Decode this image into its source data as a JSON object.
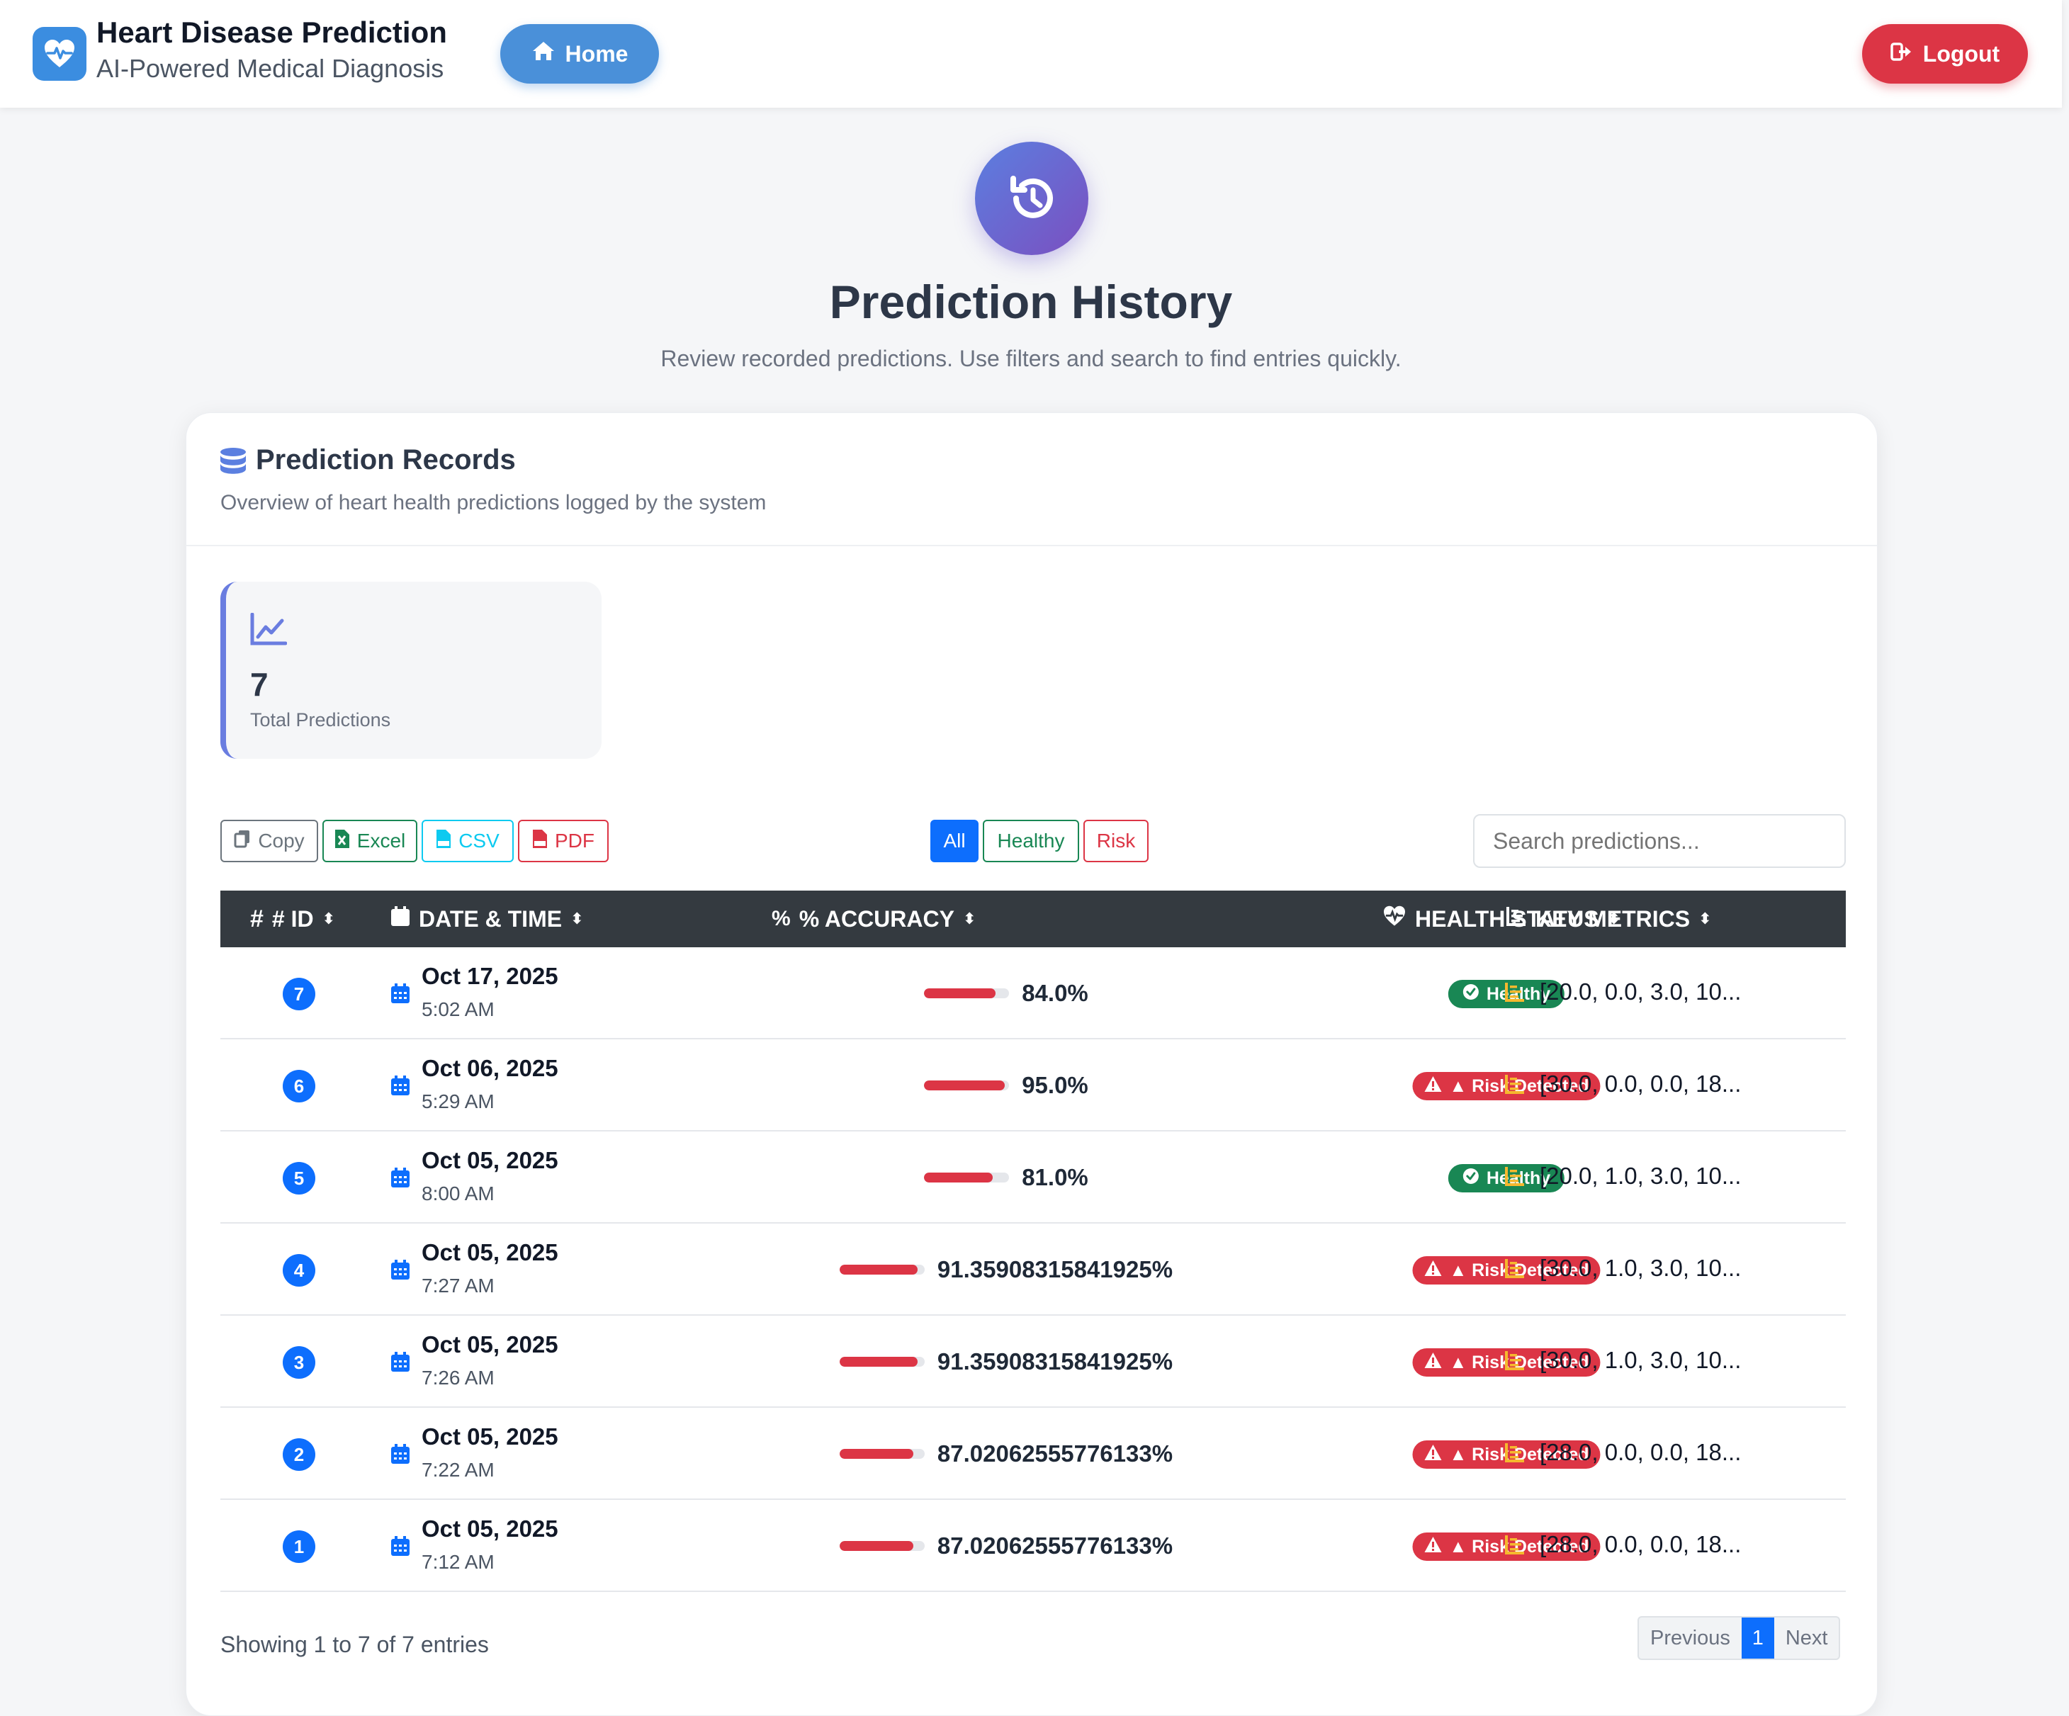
{
  "brand": {
    "title": "Heart Disease Prediction",
    "subtitle": "AI-Powered Medical Diagnosis"
  },
  "nav": {
    "home_label": "Home",
    "logout_label": "Logout"
  },
  "hero": {
    "title": "Prediction History",
    "subtitle": "Review recorded predictions. Use filters and search to find entries quickly."
  },
  "card": {
    "title": "Prediction Records",
    "subtitle": "Overview of heart health predictions logged by the system"
  },
  "stats": {
    "total_value": "7",
    "total_label": "Total Predictions"
  },
  "export_buttons": {
    "copy": "Copy",
    "excel": "Excel",
    "csv": "CSV",
    "pdf": "PDF"
  },
  "filters": {
    "all": "All",
    "healthy": "Healthy",
    "risk": "Risk"
  },
  "search": {
    "placeholder": "Search predictions..."
  },
  "table": {
    "headers": {
      "id": "# ID",
      "datetime": "DATE & TIME",
      "accuracy": "% ACCURACY",
      "status": "HEALTH STATUS",
      "metrics": "KEY METRICS"
    },
    "rows": [
      {
        "id": "7",
        "date": "Oct 17, 2025",
        "time": "5:02 AM",
        "accuracy": "84.0%",
        "accuracy_fraction": 0.84,
        "status": "Healthy",
        "status_type": "healthy",
        "metrics": "[20.0, 0.0, 3.0, 10..."
      },
      {
        "id": "6",
        "date": "Oct 06, 2025",
        "time": "5:29 AM",
        "accuracy": "95.0%",
        "accuracy_fraction": 0.95,
        "status": "▲ Risk Detected",
        "status_type": "risk",
        "metrics": "[30.0, 0.0, 0.0, 18..."
      },
      {
        "id": "5",
        "date": "Oct 05, 2025",
        "time": "8:00 AM",
        "accuracy": "81.0%",
        "accuracy_fraction": 0.81,
        "status": "Healthy",
        "status_type": "healthy",
        "metrics": "[20.0, 1.0, 3.0, 10..."
      },
      {
        "id": "4",
        "date": "Oct 05, 2025",
        "time": "7:27 AM",
        "accuracy": "91.35908315841925%",
        "accuracy_fraction": 0.9136,
        "status": "▲ Risk Detected",
        "status_type": "risk",
        "metrics": "[30.0, 1.0, 3.0, 10..."
      },
      {
        "id": "3",
        "date": "Oct 05, 2025",
        "time": "7:26 AM",
        "accuracy": "91.35908315841925%",
        "accuracy_fraction": 0.9136,
        "status": "▲ Risk Detected",
        "status_type": "risk",
        "metrics": "[30.0, 1.0, 3.0, 10..."
      },
      {
        "id": "2",
        "date": "Oct 05, 2025",
        "time": "7:22 AM",
        "accuracy": "87.02062555776133%",
        "accuracy_fraction": 0.8702,
        "status": "▲ Risk Detected",
        "status_type": "risk",
        "metrics": "[28.0, 0.0, 0.0, 18..."
      },
      {
        "id": "1",
        "date": "Oct 05, 2025",
        "time": "7:12 AM",
        "accuracy": "87.02062555776133%",
        "accuracy_fraction": 0.8702,
        "status": "▲ Risk Detected",
        "status_type": "risk",
        "metrics": "[28.0, 0.0, 0.0, 18..."
      }
    ]
  },
  "footer": {
    "showing": "Showing 1 to 7 of 7 entries",
    "previous": "Previous",
    "page": "1",
    "next": "Next"
  },
  "colors": {
    "primary": "#0d6efd",
    "danger": "#dc3545",
    "success": "#198754",
    "dark_header": "#343a40",
    "hero_gradient_start": "#5b7fe0",
    "hero_gradient_end": "#7b4fc0"
  }
}
